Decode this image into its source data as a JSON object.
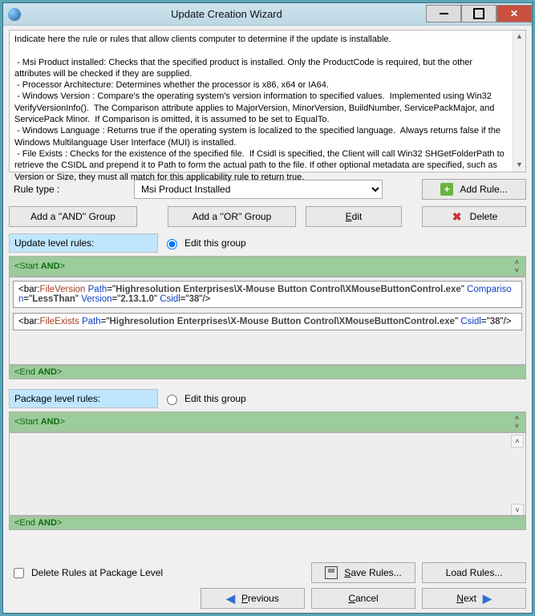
{
  "window": {
    "title": "Update Creation Wizard"
  },
  "description": "Indicate here the rule or rules that allow clients computer to determine if the update is installable.\n\n - Msi Product installed: Checks that the specified product is installed. Only the ProductCode is required, but the other attributes will be checked if they are supplied.\n - Processor Architecture: Determines whether the processor is x86, x64 or IA64.\n - Windows Version : Compare's the operating system's version information to specified values.  Implemented using Win32 VerifyVersionInfo().  The Comparison attribute applies to MajorVersion, MinorVersion, BuildNumber, ServicePackMajor, and ServicePack Minor.  If Comparison is omitted, it is assumed to be set to EqualTo.\n - Windows Language : Returns true if the operating system is localized to the specified language.  Always returns false if the Windows Multilanguage User Interface (MUI) is installed.\n - File Exists : Checks for the existence of the specified file.  If Csidl is specified, the Client will call Win32 SHGetFolderPath to retrieve the CSIDL and prepend it to Path to form the actual path to the file. If other optional metadata are specified, such as Version or Size, they must all match for this applicability rule to return true.",
  "rule_type": {
    "label": "Rule type :",
    "selected": "Msi Product Installed"
  },
  "actions": {
    "add_rule": "Add Rule...",
    "add_and": "Add a ''AND'' Group",
    "add_or": "Add a ''OR'' Group",
    "edit": "Edit",
    "delete": "Delete"
  },
  "update_level": {
    "section_label": "Update level rules:",
    "radio": "Edit this group",
    "start": "<Start AND>",
    "end": "<End AND>",
    "rules": [
      {
        "element": "FileVersion",
        "attrs": {
          "Path": "Highresolution Enterprises\\X-Mouse Button Control\\XMouseButtonControl.exe",
          "Comparison": "LessThan",
          "Version": "2.13.1.0",
          "Csidl": "38"
        }
      },
      {
        "element": "FileExists",
        "attrs": {
          "Path": "Highresolution Enterprises\\X-Mouse Button Control\\XMouseButtonControl.exe",
          "Csidl": "38"
        }
      }
    ]
  },
  "package_level": {
    "section_label": "Package level rules:",
    "radio": "Edit this group",
    "start": "<Start AND>",
    "end": "<End AND>",
    "rules": []
  },
  "footer": {
    "delete_rules_checkbox": "Delete Rules at Package Level",
    "save_rules": "Save Rules...",
    "load_rules": "Load Rules...",
    "previous": "Previous",
    "cancel": "Cancel",
    "next": "Next"
  }
}
